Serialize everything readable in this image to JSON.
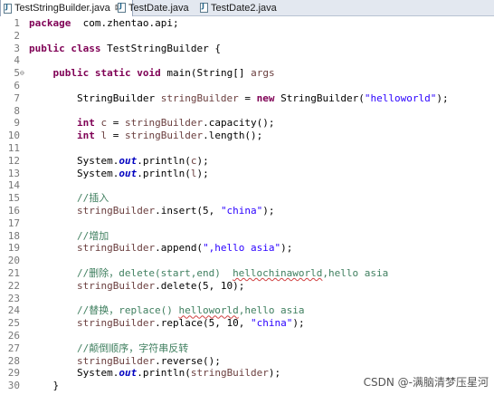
{
  "tabs": [
    {
      "label": "TestStringBuilder.java",
      "active": true,
      "close": "⊠"
    },
    {
      "label": "TestDate.java",
      "active": false
    },
    {
      "label": "TestDate2.java",
      "active": false
    }
  ],
  "lines": [
    {
      "n": "1",
      "fold": "",
      "segs": [
        [
          "kw",
          "package"
        ],
        [
          "",
          "  com.zhentao.api;"
        ]
      ]
    },
    {
      "n": "2",
      "fold": "",
      "segs": []
    },
    {
      "n": "3",
      "fold": "",
      "segs": [
        [
          "kw",
          "public"
        ],
        [
          "",
          " "
        ],
        [
          "kw",
          "class"
        ],
        [
          "",
          " TestStringBuilder {"
        ]
      ]
    },
    {
      "n": "4",
      "fold": "",
      "segs": []
    },
    {
      "n": "5",
      "fold": "⊖",
      "segs": [
        [
          "",
          "    "
        ],
        [
          "kw",
          "public"
        ],
        [
          "",
          " "
        ],
        [
          "kw",
          "static"
        ],
        [
          "",
          " "
        ],
        [
          "kw",
          "void"
        ],
        [
          "",
          " main(String[] "
        ],
        [
          "lvar",
          "args"
        ],
        [
          ") {"
        ]
      ]
    },
    {
      "n": "6",
      "fold": "",
      "segs": []
    },
    {
      "n": "7",
      "fold": "",
      "segs": [
        [
          "",
          "        StringBuilder "
        ],
        [
          "lvar",
          "stringBuilder"
        ],
        [
          "",
          " = "
        ],
        [
          "kw",
          "new"
        ],
        [
          "",
          " StringBuilder("
        ],
        [
          "str",
          "\"helloworld\""
        ],
        [
          "",
          ");"
        ]
      ]
    },
    {
      "n": "8",
      "fold": "",
      "segs": []
    },
    {
      "n": "9",
      "fold": "",
      "segs": [
        [
          "",
          "        "
        ],
        [
          "kw",
          "int"
        ],
        [
          "",
          " "
        ],
        [
          "lvar",
          "c"
        ],
        [
          "",
          " = "
        ],
        [
          "lvar",
          "stringBuilder"
        ],
        [
          "",
          ".capacity();"
        ]
      ]
    },
    {
      "n": "10",
      "fold": "",
      "segs": [
        [
          "",
          "        "
        ],
        [
          "kw",
          "int"
        ],
        [
          "",
          " "
        ],
        [
          "lvar",
          "l"
        ],
        [
          "",
          " = "
        ],
        [
          "lvar",
          "stringBuilder"
        ],
        [
          "",
          ".length();"
        ]
      ]
    },
    {
      "n": "11",
      "fold": "",
      "segs": []
    },
    {
      "n": "12",
      "fold": "",
      "segs": [
        [
          "",
          "        System."
        ],
        [
          "fld",
          "out"
        ],
        [
          "",
          ".println("
        ],
        [
          "lvar",
          "c"
        ],
        [
          "",
          ");"
        ]
      ]
    },
    {
      "n": "13",
      "fold": "",
      "segs": [
        [
          "",
          "        System."
        ],
        [
          "fld",
          "out"
        ],
        [
          "",
          ".println("
        ],
        [
          "lvar",
          "l"
        ],
        [
          "",
          ");"
        ]
      ]
    },
    {
      "n": "14",
      "fold": "",
      "segs": []
    },
    {
      "n": "15",
      "fold": "",
      "segs": [
        [
          "",
          "        "
        ],
        [
          "cmt",
          "//插入"
        ]
      ]
    },
    {
      "n": "16",
      "fold": "",
      "segs": [
        [
          "",
          "        "
        ],
        [
          "lvar",
          "stringBuilder"
        ],
        [
          "",
          ".insert(5, "
        ],
        [
          "str",
          "\"china\""
        ],
        [
          "",
          ");"
        ]
      ]
    },
    {
      "n": "17",
      "fold": "",
      "segs": []
    },
    {
      "n": "18",
      "fold": "",
      "segs": [
        [
          "",
          "        "
        ],
        [
          "cmt",
          "//增加"
        ]
      ]
    },
    {
      "n": "19",
      "fold": "",
      "segs": [
        [
          "",
          "        "
        ],
        [
          "lvar",
          "stringBuilder"
        ],
        [
          "",
          ".append("
        ],
        [
          "str",
          "\",hello asia\""
        ],
        [
          "",
          ");"
        ]
      ]
    },
    {
      "n": "20",
      "fold": "",
      "segs": []
    },
    {
      "n": "21",
      "fold": "",
      "segs": [
        [
          "",
          "        "
        ],
        [
          "cmt",
          "//删除，delete(start,end)  "
        ],
        [
          "cmt typo",
          "hellochinaworld"
        ],
        [
          "cmt",
          ",hello asia"
        ]
      ]
    },
    {
      "n": "22",
      "fold": "",
      "segs": [
        [
          "",
          "        "
        ],
        [
          "lvar",
          "stringBuilder"
        ],
        [
          "",
          ".delete(5, 10);"
        ]
      ]
    },
    {
      "n": "23",
      "fold": "",
      "segs": []
    },
    {
      "n": "24",
      "fold": "",
      "segs": [
        [
          "",
          "        "
        ],
        [
          "cmt",
          "//替换，replace() "
        ],
        [
          "cmt typo",
          "helloworld"
        ],
        [
          "cmt",
          ",hello asia"
        ]
      ]
    },
    {
      "n": "25",
      "fold": "",
      "segs": [
        [
          "",
          "        "
        ],
        [
          "lvar",
          "stringBuilder"
        ],
        [
          "",
          ".replace(5, 10, "
        ],
        [
          "str",
          "\"china\""
        ],
        [
          "",
          ");"
        ]
      ]
    },
    {
      "n": "26",
      "fold": "",
      "segs": []
    },
    {
      "n": "27",
      "fold": "",
      "segs": [
        [
          "",
          "        "
        ],
        [
          "cmt",
          "//颠倒顺序，字符串反转"
        ]
      ]
    },
    {
      "n": "28",
      "fold": "",
      "segs": [
        [
          "",
          "        "
        ],
        [
          "lvar",
          "stringBuilder"
        ],
        [
          "",
          ".reverse();"
        ]
      ]
    },
    {
      "n": "29",
      "fold": "",
      "segs": [
        [
          "",
          "        System."
        ],
        [
          "fld",
          "out"
        ],
        [
          "",
          ".println("
        ],
        [
          "lvar",
          "stringBuilder"
        ],
        [
          "",
          ");"
        ]
      ]
    },
    {
      "n": "30",
      "fold": "",
      "segs": [
        [
          "",
          "    }"
        ]
      ]
    }
  ],
  "watermark": "CSDN @-满脑清梦压星河",
  "colors": {
    "keyword": "#7f0055",
    "string": "#2a00ff",
    "comment": "#3f7f5f",
    "field": "#0000c0",
    "local": "#6a3e3e",
    "line_number": "#787878"
  }
}
